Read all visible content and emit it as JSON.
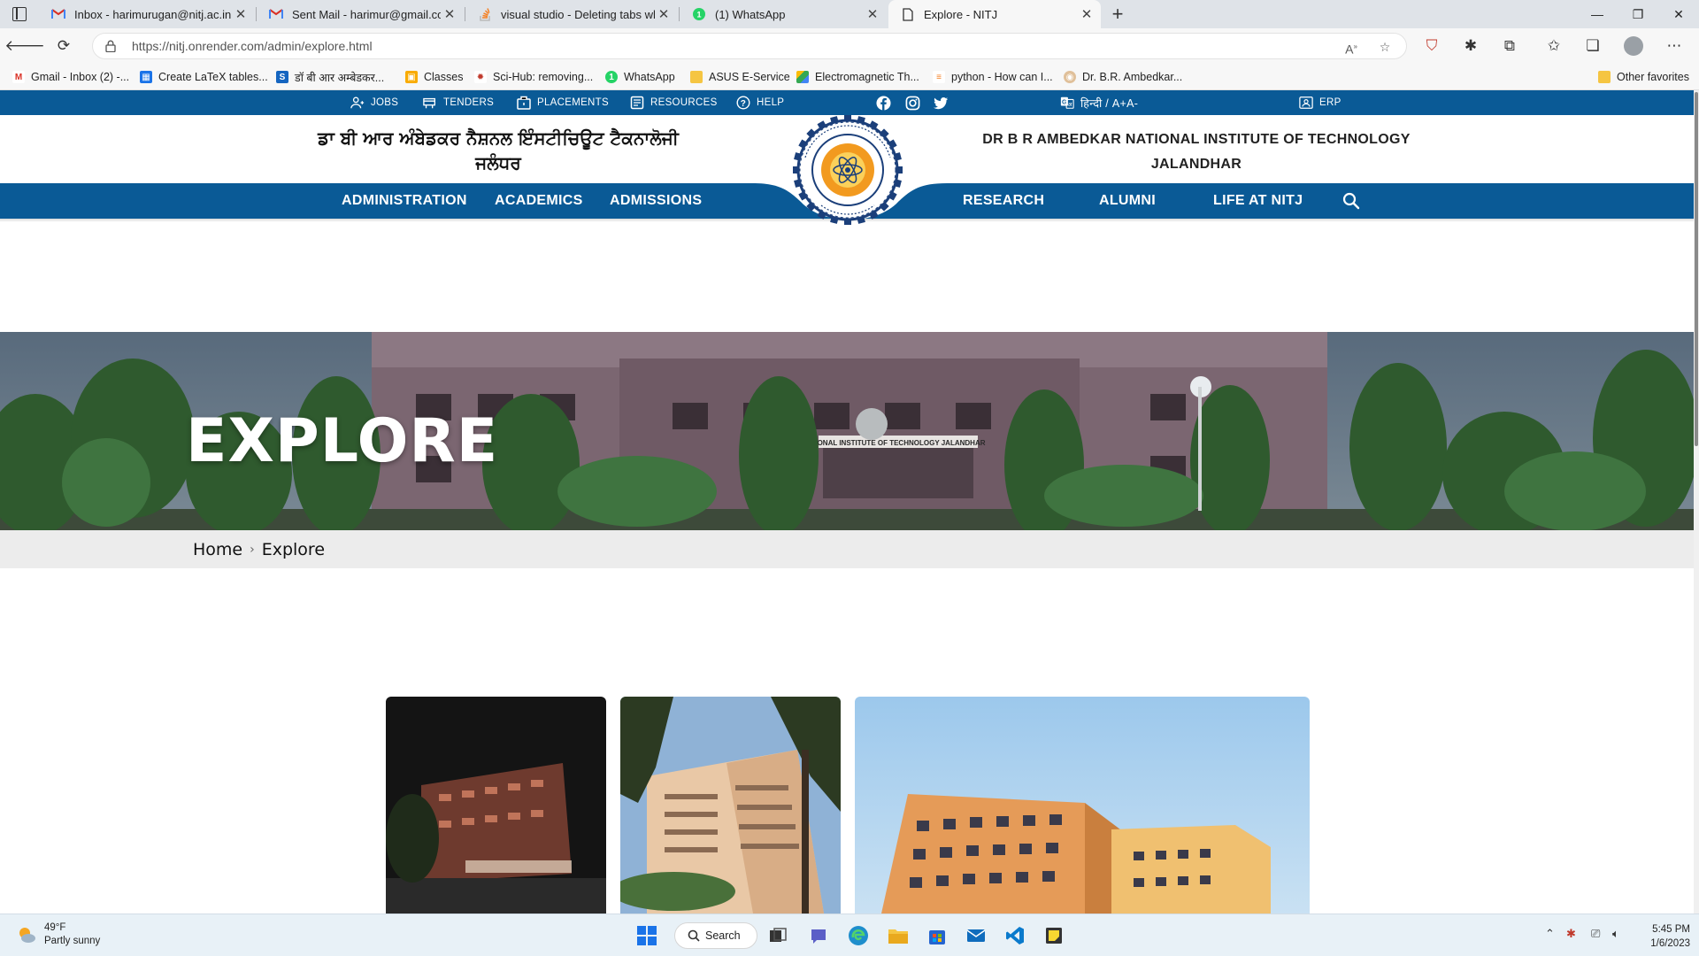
{
  "browser": {
    "tabs": [
      {
        "label": "Inbox - harimurugan@nitj.ac.in ·",
        "icon": "gmail-icon"
      },
      {
        "label": "Sent Mail - harimur@gmail.com",
        "icon": "gmail-icon"
      },
      {
        "label": "visual studio - Deleting tabs whe",
        "icon": "stackoverflow-icon"
      },
      {
        "label": "(1) WhatsApp",
        "icon": "whatsapp-icon"
      },
      {
        "label": "Explore - NITJ",
        "icon": "page-icon"
      }
    ],
    "new_tab": "+",
    "url": "https://nitj.onrender.com/admin/explore.html",
    "favorites": [
      {
        "label": "Gmail - Inbox (2) -...",
        "icon": "gmail-icon"
      },
      {
        "label": "Create LaTeX tables...",
        "icon": "table-icon"
      },
      {
        "label": "डॉ बी आर अम्बेडकर...",
        "icon": "s-icon"
      },
      {
        "label": "Classes",
        "icon": "classroom-icon"
      },
      {
        "label": "Sci-Hub: removing...",
        "icon": "scihub-icon"
      },
      {
        "label": "WhatsApp",
        "icon": "whatsapp-icon"
      },
      {
        "label": "ASUS E-Service",
        "icon": "folder-icon"
      },
      {
        "label": "Electromagnetic Th...",
        "icon": "drive-icon"
      },
      {
        "label": "python - How can I...",
        "icon": "stackoverflow-icon"
      },
      {
        "label": "Dr. B.R. Ambedkar...",
        "icon": "globe-icon"
      }
    ],
    "other_favorites": "Other favorites"
  },
  "site": {
    "util": {
      "jobs": "JOBS",
      "tenders": "TENDERS",
      "placements": "PLACEMENTS",
      "resources": "RESOURCES",
      "help": "HELP",
      "lang": "हिन्दी / A+A-",
      "erp": "ERP"
    },
    "header": {
      "punjabi_line1": "ਡਾ ਬੀ ਆਰ ਅੰਬੇਡਕਰ ਨੈਸ਼ਨਲ ਇੰਸਟੀਚਿਊਟ ਟੈਕਨਾਲੋਜੀ",
      "punjabi_line2": "ਜਲੰਧਰ",
      "english_line1": "DR B R AMBEDKAR NATIONAL INSTITUTE OF TECHNOLOGY",
      "english_line2": "JALANDHAR"
    },
    "nav": {
      "administration": "ADMINISTRATION",
      "academics": "ACADEMICS",
      "admissions": "ADMISSIONS",
      "research": "RESEARCH",
      "alumni": "ALUMNI",
      "life": "LIFE AT NITJ"
    },
    "hero_title": "EXPLORE",
    "hero_sign": "TIONAL INSTITUTE OF TECHNOLOGY JALANDHAR",
    "breadcrumb": {
      "home": "Home",
      "separator": "›",
      "current": "Explore"
    }
  },
  "taskbar": {
    "weather_temp": "49°F",
    "weather_desc": "Partly sunny",
    "search": "Search",
    "time": "5:45 PM",
    "date": "1/6/2023"
  },
  "colors": {
    "brand_blue": "#0a5a96",
    "breadcrumb_bg": "#ececec"
  }
}
